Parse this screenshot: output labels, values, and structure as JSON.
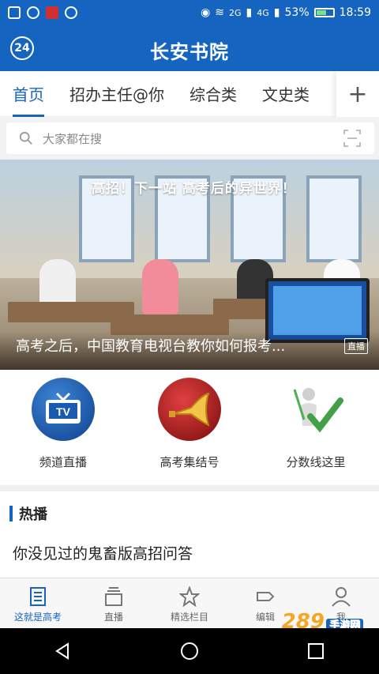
{
  "status_bar": {
    "network_labels": [
      "2G",
      "4G"
    ],
    "battery": "53%",
    "time": "18:59"
  },
  "top_bar": {
    "badge": "24",
    "logo": "长安书院"
  },
  "tabs": [
    {
      "label": "首页",
      "active": true
    },
    {
      "label": "招办主任@你",
      "active": false
    },
    {
      "label": "综合类",
      "active": false
    },
    {
      "label": "文史类",
      "active": false
    }
  ],
  "tabs_more_icon": "plus-icon",
  "search": {
    "placeholder": "大家都在搜"
  },
  "banner": {
    "headline": "高招！下一站 高考后的异世界！",
    "caption": "高考之后，中国教育电视台教你如何报考...",
    "tag": "直播"
  },
  "quick_entries": [
    {
      "label": "频道直播",
      "icon": "tv-icon",
      "color": "#1a5bb0"
    },
    {
      "label": "高考集结号",
      "icon": "horn-icon",
      "color": "#b71c1c"
    },
    {
      "label": "分数线这里",
      "icon": "check-figure-icon",
      "color": "#43a047"
    }
  ],
  "hot": {
    "title": "热播",
    "first_item": "你没见过的鬼畜版高招问答"
  },
  "bottom_nav": [
    {
      "label": "这就是高考",
      "icon": "book-icon",
      "active": true
    },
    {
      "label": "直播",
      "icon": "stack-icon",
      "active": false
    },
    {
      "label": "精选栏目",
      "icon": "star-icon",
      "active": false
    },
    {
      "label": "编辑",
      "icon": "tag-icon",
      "active": false
    },
    {
      "label": "我",
      "icon": "user-icon",
      "active": false
    }
  ],
  "watermark": {
    "main": "289",
    "sub": "手游网"
  },
  "colors": {
    "brand": "#1565c0",
    "tab_active": "#1565c0"
  }
}
